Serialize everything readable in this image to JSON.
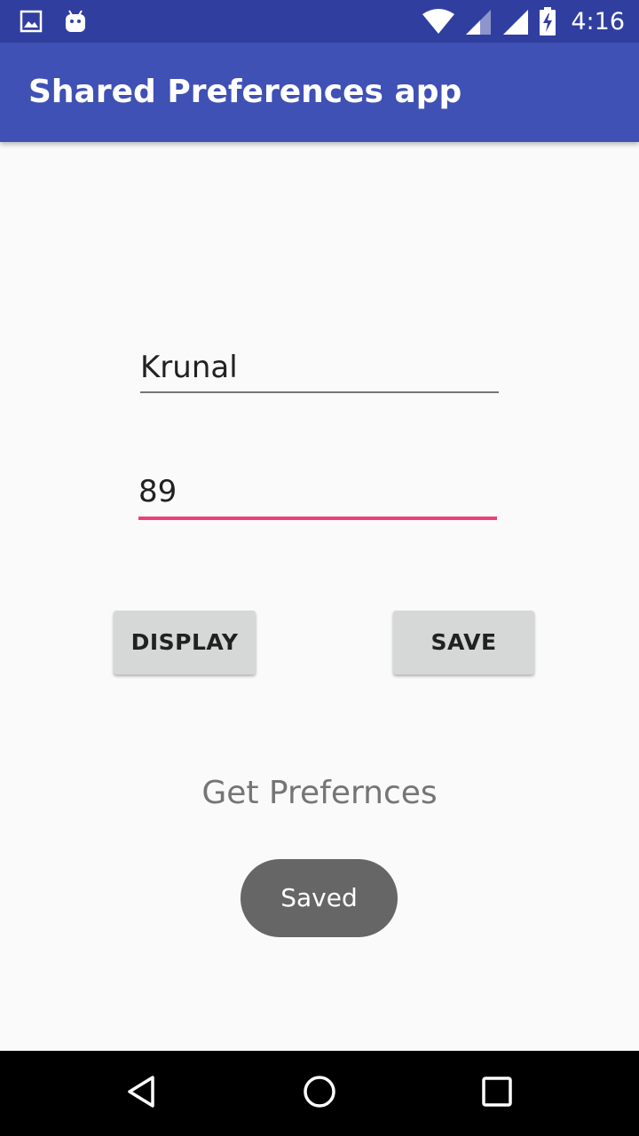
{
  "status_bar": {
    "time": "4:16",
    "icons": [
      "gallery-icon",
      "android-icon",
      "wifi-icon",
      "signal-icon",
      "signal-icon",
      "battery-charging-icon"
    ]
  },
  "app_bar": {
    "title": "Shared Preferences app",
    "color": "#3f51b5",
    "status_color": "#303f9f"
  },
  "form": {
    "name_value": "Krunal",
    "age_value": "89",
    "accent_color": "#ec407a"
  },
  "buttons": {
    "display_label": "DISPLAY",
    "save_label": "SAVE"
  },
  "get_preferences_text": "Get Prefernces",
  "toast": {
    "message": "Saved"
  },
  "nav_bar": {
    "icons": [
      "back-icon",
      "home-icon",
      "recent-apps-icon"
    ]
  }
}
